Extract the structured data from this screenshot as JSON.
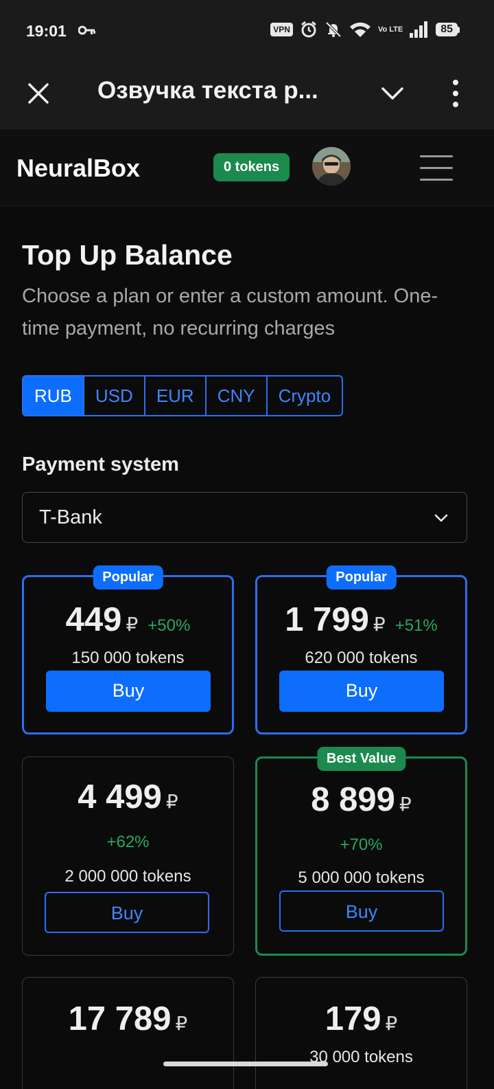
{
  "status_bar": {
    "time": "19:01",
    "vpn_label": "VPN",
    "volte_label": "Vo LTE",
    "battery_level": "85",
    "icons": [
      "key-icon",
      "alarm-icon",
      "mute-icon",
      "wifi-icon",
      "signal-icon"
    ]
  },
  "toolbar": {
    "title": "Озвучка текста р...",
    "close_icon": "close-icon",
    "chevron_icon": "chevron-down-icon",
    "more_icon": "more-vertical-icon"
  },
  "header": {
    "logo": "NeuralBox",
    "tokens_badge": "0 tokens",
    "menu_icon": "hamburger-menu-icon"
  },
  "page": {
    "title": "Top Up Balance",
    "subtitle": "Choose a plan or enter a custom amount. One-time payment, no recurring charges",
    "currencies": [
      {
        "label": "RUB",
        "active": true
      },
      {
        "label": "USD",
        "active": false
      },
      {
        "label": "EUR",
        "active": false
      },
      {
        "label": "CNY",
        "active": false
      },
      {
        "label": "Crypto",
        "active": false
      }
    ],
    "payment_label": "Payment system",
    "payment_value": "T-Bank"
  },
  "plans": [
    {
      "badge": "Popular",
      "price": "449",
      "currency": "₽",
      "bonus": "+50%",
      "tokens": "150 000 tokens",
      "buy": "Buy"
    },
    {
      "badge": "Popular",
      "price": "1 799",
      "currency": "₽",
      "bonus": "+51%",
      "tokens": "620 000 tokens",
      "buy": "Buy"
    },
    {
      "price": "4 499",
      "currency": "₽",
      "bonus": "+62%",
      "tokens": "2 000 000 tokens",
      "buy": "Buy"
    },
    {
      "badge": "Best Value",
      "price": "8 899",
      "currency": "₽",
      "bonus": "+70%",
      "tokens": "5 000 000 tokens",
      "buy": "Buy"
    },
    {
      "price": "17 789",
      "currency": "₽"
    },
    {
      "price": "179",
      "currency": "₽",
      "tokens": "30 000 tokens"
    }
  ],
  "colors": {
    "accent_blue": "#0d6efd",
    "accent_green": "#1c8a4f",
    "background": "#0b0b0c"
  }
}
